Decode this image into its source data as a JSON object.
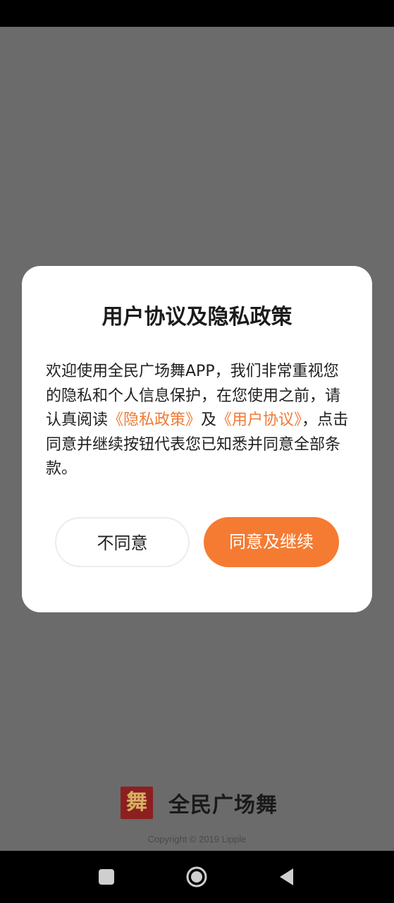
{
  "dialog": {
    "title": "用户协议及隐私政策",
    "body_intro": "欢迎使用全民广场舞APP，我们非常重视您的隐私和个人信息保护，在您使用之前，请认真阅读",
    "privacy_link": "《隐私政策》",
    "conjunction": "及",
    "user_agreement_link": "《用户协议》",
    "body_outro": "，点击同意并继续按钮代表您已知悉并同意全部条款。",
    "decline_label": "不同意",
    "accept_label": "同意及继续",
    "accent_color": "#f57b32"
  },
  "brand": {
    "logo_glyph": "舞",
    "name": "全民广场舞",
    "copyright": "Copyright © 2019 Lipple"
  },
  "nav": {
    "recents": "recents-square-icon",
    "home": "home-circle-icon",
    "back": "back-triangle-icon"
  }
}
